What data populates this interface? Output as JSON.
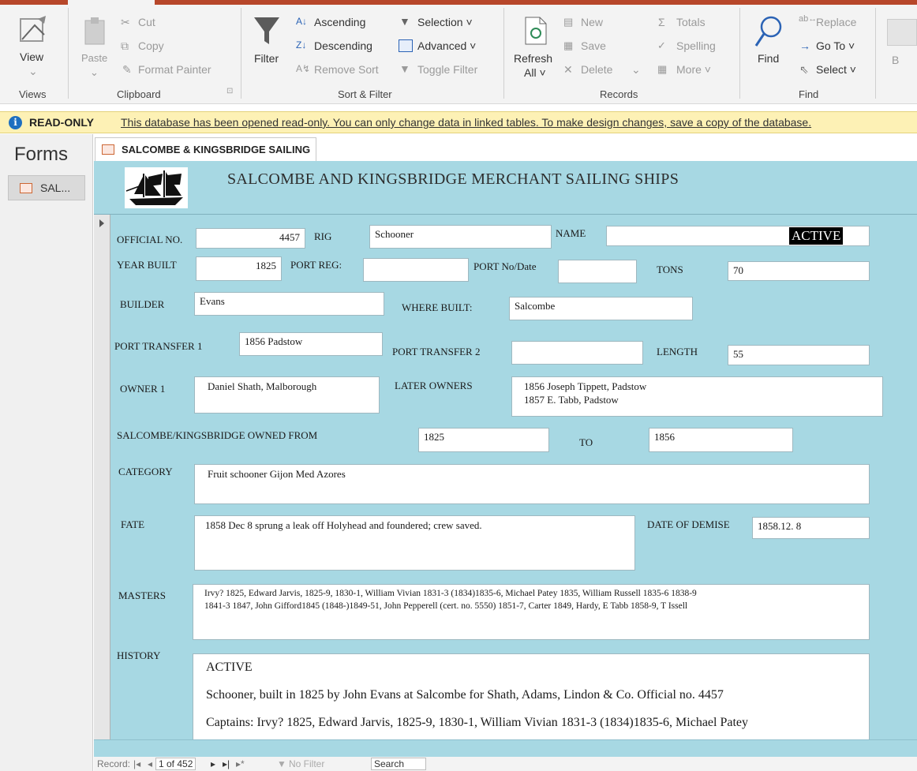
{
  "ribbon": {
    "views": {
      "view_label": "View",
      "group": "Views"
    },
    "clipboard": {
      "paste_label": "Paste",
      "cut": "Cut",
      "copy": "Copy",
      "format_painter": "Format Painter",
      "group": "Clipboard"
    },
    "sort_filter": {
      "filter_label": "Filter",
      "ascending": "Ascending",
      "descending": "Descending",
      "remove_sort": "Remove Sort",
      "selection": "Selection ˅",
      "advanced": "Advanced ˅",
      "toggle_filter": "Toggle Filter",
      "group": "Sort & Filter"
    },
    "records": {
      "refresh_label": "Refresh",
      "refresh_all": "All ˅",
      "new": "New",
      "save": "Save",
      "delete": "Delete",
      "totals": "Totals",
      "spelling": "Spelling",
      "more": "More ˅",
      "group": "Records"
    },
    "find": {
      "find_label": "Find",
      "replace": "Replace",
      "goto": "Go To ˅",
      "select": "Select ˅",
      "group": "Find"
    },
    "partial_b": "B"
  },
  "infobar": {
    "title": "READ-ONLY",
    "message": "This database has been opened read-only. You can only change data in linked tables. To make design changes, save a copy of the database."
  },
  "navpane": {
    "title": "Forms",
    "item": "SAL..."
  },
  "doctab": {
    "label": "SALCOMBE & KINGSBRIDGE SAILING"
  },
  "form": {
    "title": "SALCOMBE AND KINGSBRIDGE MERCHANT SAILING SHIPS",
    "labels": {
      "official_no": "OFFICIAL NO.",
      "rig": "RIG",
      "name": "NAME",
      "year_built": "YEAR BUILT",
      "port_reg": "PORT REG:",
      "port_no_date": "PORT No/Date",
      "tons": "TONS",
      "builder": "BUILDER",
      "where_built": "WHERE BUILT:",
      "port_transfer_1": "PORT TRANSFER 1",
      "port_transfer_2": "PORT TRANSFER 2",
      "length": "LENGTH",
      "owner_1": "OWNER 1",
      "later_owners": "LATER OWNERS",
      "owned_from": "SALCOMBE/KINGSBRIDGE OWNED FROM",
      "to": "TO",
      "category": "CATEGORY",
      "fate": "FATE",
      "date_of_demise": "DATE OF DEMISE",
      "masters": "MASTERS",
      "history": "HISTORY"
    },
    "values": {
      "official_no": "4457",
      "rig": "Schooner",
      "name": "ACTIVE",
      "year_built": "1825",
      "port_reg": "",
      "port_no_date": "",
      "tons": "70",
      "builder": "Evans",
      "where_built": "Salcombe",
      "port_transfer_1": "1856 Padstow",
      "port_transfer_2": "",
      "length": "55",
      "owner_1": "Daniel Shath, Malborough",
      "later_owners_1": "1856 Joseph Tippett, Padstow",
      "later_owners_2": "1857 E. Tabb, Padstow",
      "owned_from": "1825",
      "to": "1856",
      "category": "Fruit schooner Gijon Med Azores",
      "fate": "1858 Dec 8 sprung a leak off Holyhead and foundered; crew saved.",
      "date_of_demise": "1858.12. 8",
      "masters_1": "Irvy? 1825, Edward Jarvis, 1825-9, 1830-1, William Vivian 1831-3 (1834)1835-6, Michael Patey 1835, William Russell 1835-6 1838-9",
      "masters_2": "1841-3 1847, John Gifford1845 (1848-)1849-51, John Pepperell (cert. no. 5550) 1851-7, Carter 1849,  Hardy, E Tabb 1858-9, T Issell",
      "history_1": "ACTIVE",
      "history_2": "Schooner, built in 1825 by John Evans at Salcombe for Shath, Adams, Lindon & Co. Official no. 4457",
      "history_3": "Captains: Irvy? 1825, Edward Jarvis, 1825-9, 1830-1, William Vivian 1831-3 (1834)1835-6, Michael Patey"
    }
  },
  "recordbar": {
    "record_label": "Record:",
    "position": "1 of 452",
    "no_filter": "No Filter",
    "search": "Search"
  },
  "colors": {
    "form_bg": "#a7d8e3",
    "infobar_bg": "#fdf1b5",
    "accent": "#b7472a"
  }
}
